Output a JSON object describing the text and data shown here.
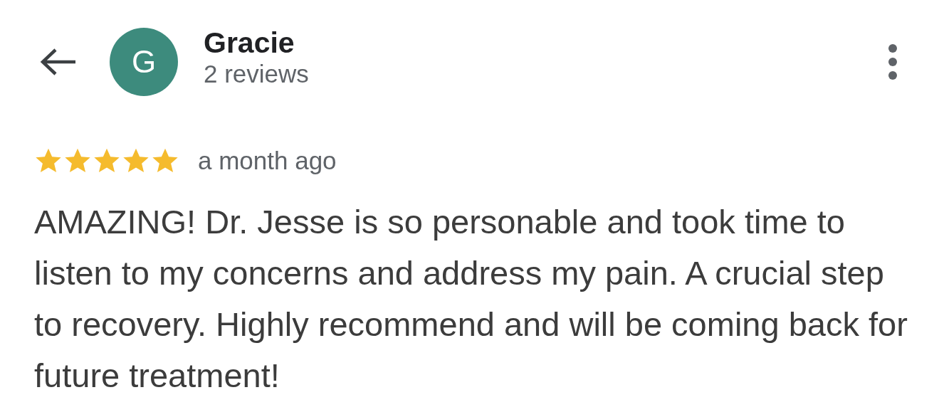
{
  "reviewer": {
    "name": "Gracie",
    "initial": "G",
    "review_count": "2 reviews"
  },
  "review": {
    "stars": 5,
    "time": "a month ago",
    "text": "AMAZING! Dr. Jesse is so personable and took time to listen to my concerns and address my pain. A crucial step to recovery. Highly recommend and will be coming back for future treatment!"
  }
}
